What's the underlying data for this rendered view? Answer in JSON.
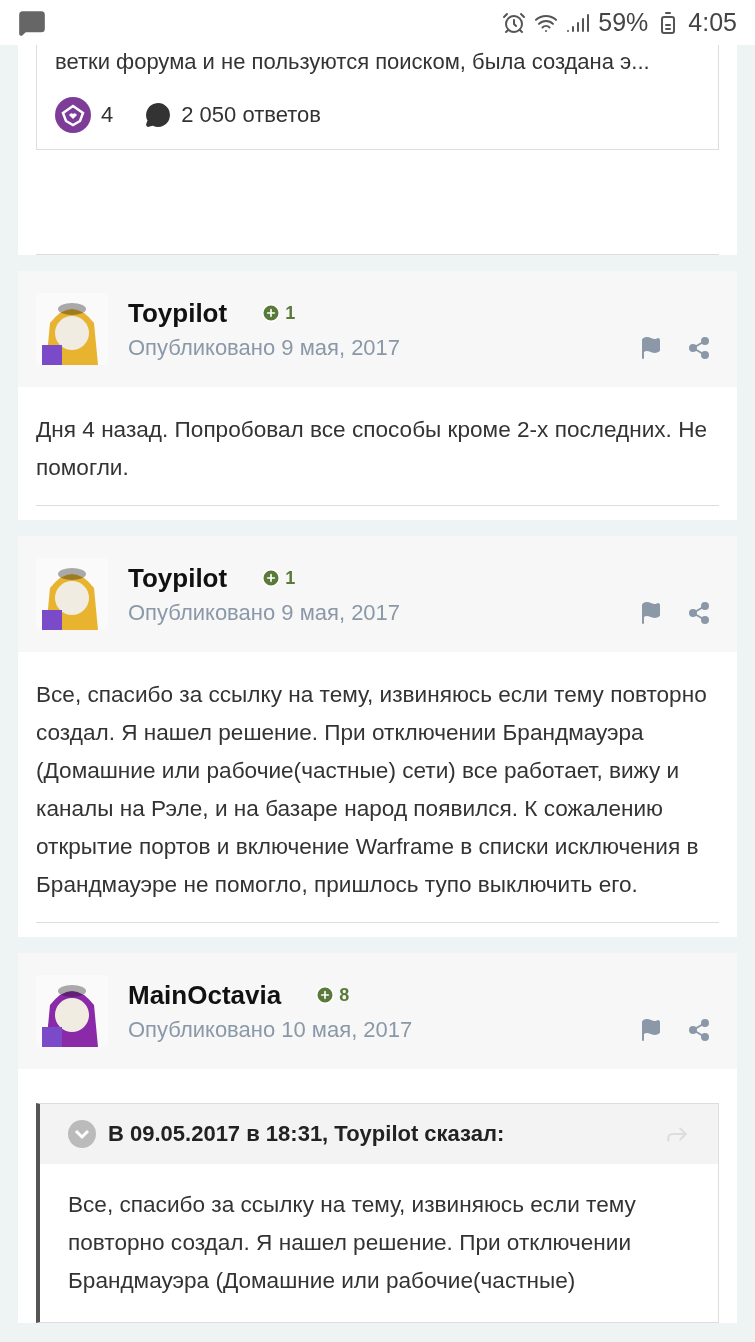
{
  "status_bar": {
    "battery": "59%",
    "time": "4:05"
  },
  "topic_preview": {
    "excerpt": "ветки форума и не пользуются поиском, была создана э...",
    "reactions": "4",
    "replies": "2 050 ответов"
  },
  "posts": [
    {
      "author": "Toypilot",
      "reputation": "1",
      "date": "Опубликовано 9 мая, 2017",
      "body": "Дня 4 назад. Попробовал все способы кроме 2-х последних. Не помогли."
    },
    {
      "author": "Toypilot",
      "reputation": "1",
      "date": "Опубликовано 9 мая, 2017",
      "body": "Все, спасибо за ссылку на тему, извиняюсь если тему повторно создал. Я нашел решение. При отключении Брандмауэра (Домашние или рабочие(частные) сети) все работает, вижу и каналы на Рэле, и на базаре народ появился. К сожалению открытие портов и включение Warframe в списки исключения в Брандмауэре не помогло, пришлось тупо выключить его."
    },
    {
      "author": "MainOctavia",
      "reputation": "8",
      "date": "Опубликовано 10 мая, 2017",
      "quote": {
        "header": "В 09.05.2017 в 18:31, Toypilot сказал:",
        "text": "Все, спасибо за ссылку на тему, извиняюсь если тему повторно создал. Я нашел решение. При отключении Брандмауэра (Домашние или рабочие(частные)"
      }
    }
  ]
}
